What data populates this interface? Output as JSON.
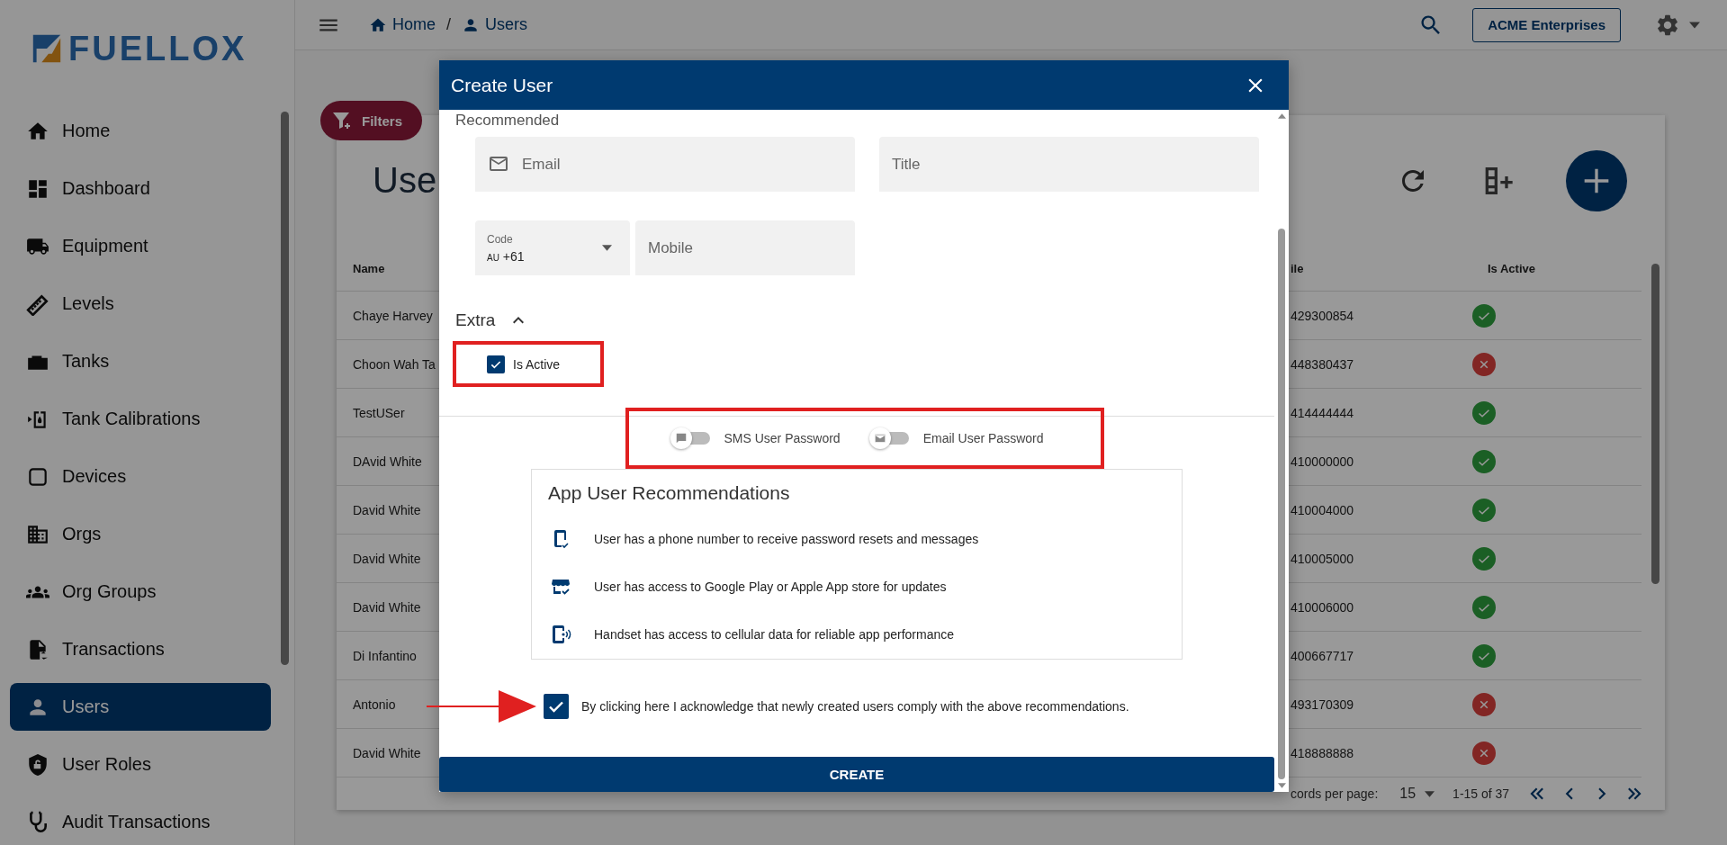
{
  "brand": {
    "name": "FUELLOX"
  },
  "sidebar": {
    "items": [
      {
        "label": "Home",
        "selected": false
      },
      {
        "label": "Dashboard",
        "selected": false
      },
      {
        "label": "Equipment",
        "selected": false
      },
      {
        "label": "Levels",
        "selected": false
      },
      {
        "label": "Tanks",
        "selected": false
      },
      {
        "label": "Tank Calibrations",
        "selected": false
      },
      {
        "label": "Devices",
        "selected": false
      },
      {
        "label": "Orgs",
        "selected": false
      },
      {
        "label": "Org Groups",
        "selected": false
      },
      {
        "label": "Transactions",
        "selected": false
      },
      {
        "label": "Users",
        "selected": true
      },
      {
        "label": "User Roles",
        "selected": false
      },
      {
        "label": "Audit Transactions",
        "selected": false
      }
    ]
  },
  "breadcrumb": [
    {
      "label": "Home"
    },
    {
      "label": "/"
    },
    {
      "label": "Users"
    }
  ],
  "org_button": "ACME Enterprises",
  "filters_button": "Filters",
  "page_title": "Use",
  "table": {
    "columns": [
      "Name",
      "ile",
      "Is Active"
    ],
    "rows": [
      {
        "name": "Chaye Harvey",
        "mobile": "429300854",
        "active": true
      },
      {
        "name": "Choon Wah Ta",
        "mobile": "448380437",
        "active": false
      },
      {
        "name": "TestUSer",
        "mobile": "414444444",
        "active": true
      },
      {
        "name": "DAvid White",
        "mobile": "410000000",
        "active": true
      },
      {
        "name": "David White",
        "mobile": "410004000",
        "active": true
      },
      {
        "name": "David White",
        "mobile": "410005000",
        "active": true
      },
      {
        "name": "David White",
        "mobile": "410006000",
        "active": true
      },
      {
        "name": "Di Infantino",
        "mobile": "400667717",
        "active": true
      },
      {
        "name": "Antonio",
        "mobile": "493170309",
        "active": false
      },
      {
        "name": "David White",
        "mobile": "418888888",
        "active": false
      }
    ],
    "footer": {
      "rows_label": "cords per page:",
      "rows_value": "15",
      "range": "1-15 of 37"
    }
  },
  "dialog": {
    "title": "Create User",
    "section": "Recommended",
    "email": {
      "placeholder": "Email"
    },
    "job_title": {
      "placeholder": "Title"
    },
    "code": {
      "label": "Code",
      "country": "AU",
      "value": "+61"
    },
    "mobile": {
      "placeholder": "Mobile"
    },
    "extra": {
      "label": "Extra",
      "expanded": true,
      "is_active": {
        "label": "Is Active",
        "checked": true,
        "highlighted": true
      }
    },
    "toggles_highlighted": true,
    "toggles": [
      {
        "label": "SMS User Password",
        "on": false
      },
      {
        "label": "Email User Password",
        "on": false
      }
    ],
    "recommendations": {
      "title": "App User Recommendations",
      "items": [
        {
          "text": "User has a phone number to receive password resets and messages"
        },
        {
          "text": "User has access to Google Play or Apple App store for updates"
        },
        {
          "text": "Handset has access to cellular data for reliable app performance"
        }
      ]
    },
    "acknowledgement": {
      "text": "By clicking here I acknowledge that newly created users comply with the above recommendations.",
      "checked": true,
      "pointed": true
    },
    "submit": "CREATE"
  }
}
